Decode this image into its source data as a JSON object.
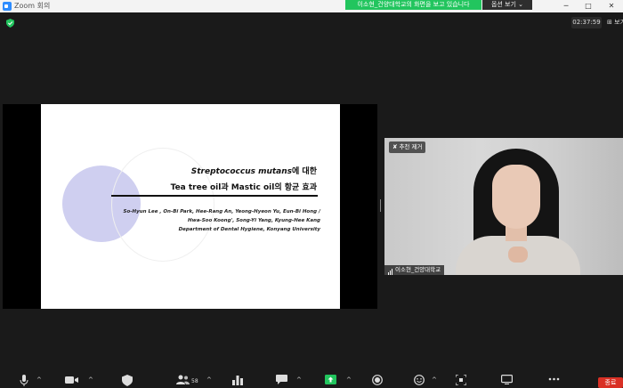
{
  "window": {
    "title": "Zoom 회의",
    "share_banner": "이소현_건양대학교의 화면을 보고 있습니다",
    "options_label": "옵션 보기 ⌄",
    "minimize": "─",
    "maximize": "□",
    "close": "✕"
  },
  "meeting": {
    "timer": "02:37:59",
    "view_label": "보기"
  },
  "slide": {
    "title_italic": "Streptococcus mutans",
    "title_suffix": "에 대한",
    "title_line2": "Tea tree oil과 Mastic oil의 항균 효과",
    "authors_line1": "So-Hyun Lee , On-Bi Park, Hee-Rang An, Yeong-Hyeon Yu, Eun-Bi Hong /",
    "authors_line2": "Hwa-Soo Koong', Song-Yi Yang, Kyung-Hee Kang",
    "department": "Department of Dental Hygiene, Konyang University"
  },
  "video": {
    "unpin_label": "추천 제거",
    "participant_name": "이소현_건양대학교"
  },
  "toolbar": {
    "participants_count": "58",
    "end_label": "종료"
  },
  "colors": {
    "share_banner": "#22c55e",
    "end_button": "#d93025",
    "slide_circle": "#cfcff0"
  }
}
